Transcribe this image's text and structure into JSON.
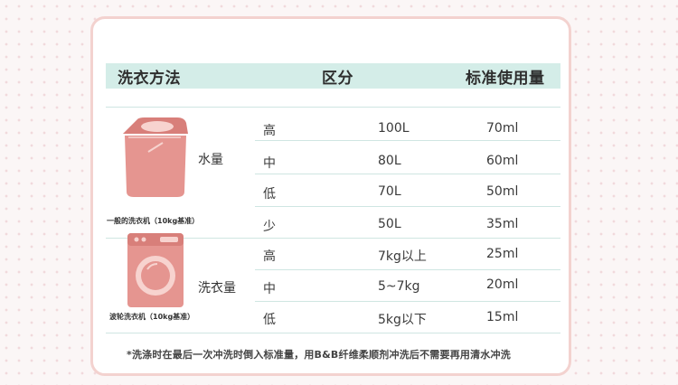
{
  "table": {
    "headers": [
      "洗衣方法",
      "区分",
      "标准使用量"
    ],
    "groups": [
      {
        "label": "水量",
        "caption": "一般的洗衣机（10kg基准）",
        "icon": "top-load-washer-icon",
        "rows": [
          {
            "level": "高",
            "amount": "100L",
            "usage": "70ml"
          },
          {
            "level": "中",
            "amount": "80L",
            "usage": "60ml"
          },
          {
            "level": "低",
            "amount": "70L",
            "usage": "50ml"
          },
          {
            "level": "少",
            "amount": "50L",
            "usage": "35ml"
          }
        ]
      },
      {
        "label": "洗衣量",
        "caption": "波轮洗衣机（10kg基准）",
        "icon": "front-load-washer-icon",
        "rows": [
          {
            "level": "高",
            "amount": "7kg以上",
            "usage": "25ml"
          },
          {
            "level": "中",
            "amount": "5~7kg",
            "usage": "20ml"
          },
          {
            "level": "低",
            "amount": "5kg以下",
            "usage": "15ml"
          }
        ]
      }
    ]
  },
  "footnote": "*洗涤时在最后一次冲洗时倒入标准量，用B&B纤维柔顺剂冲洗后不需要再用清水冲洗",
  "colors": {
    "header_bg": "#d4ede8",
    "washer": "#e59590",
    "card_border": "#f3d2cf"
  }
}
